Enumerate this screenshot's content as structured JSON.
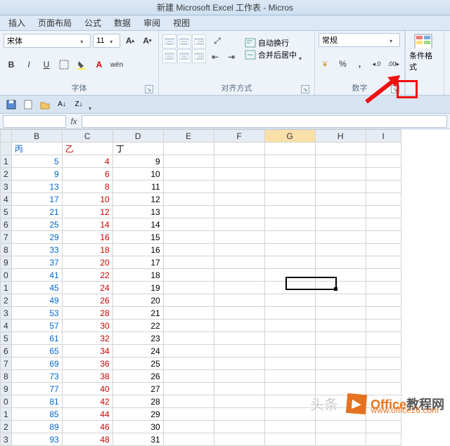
{
  "title": "新建 Microsoft Excel 工作表 - Micros",
  "tabs": {
    "insert": "插入",
    "layout": "页面布局",
    "formula": "公式",
    "data": "数据",
    "review": "审阅",
    "view": "视图"
  },
  "font": {
    "family": "宋体",
    "size": "11",
    "bold": "B",
    "italic": "I",
    "underline": "U"
  },
  "groups": {
    "font": "字体",
    "align": "对齐方式",
    "number": "数字",
    "style": "条件格式"
  },
  "align": {
    "wrap": "自动换行",
    "merge": "合并后居中"
  },
  "number": {
    "format": "常规",
    "pct": "%",
    "comma": ",",
    "inc": ".0",
    "dec": ".00"
  },
  "columns": [
    "B",
    "C",
    "D",
    "E",
    "F",
    "G",
    "H",
    "I"
  ],
  "headers": {
    "B": "丙",
    "C": "乙",
    "D": "丁"
  },
  "rows": [
    {
      "r": "1",
      "B": 5,
      "C": 4,
      "D": 9
    },
    {
      "r": "2",
      "B": 9,
      "C": 6,
      "D": 10
    },
    {
      "r": "3",
      "B": 13,
      "C": 8,
      "D": 11
    },
    {
      "r": "4",
      "B": 17,
      "C": 10,
      "D": 12
    },
    {
      "r": "5",
      "B": 21,
      "C": 12,
      "D": 13
    },
    {
      "r": "6",
      "B": 25,
      "C": 14,
      "D": 14
    },
    {
      "r": "7",
      "B": 29,
      "C": 16,
      "D": 15
    },
    {
      "r": "8",
      "B": 33,
      "C": 18,
      "D": 16
    },
    {
      "r": "9",
      "B": 37,
      "C": 20,
      "D": 17
    },
    {
      "r": "0",
      "B": 41,
      "C": 22,
      "D": 18
    },
    {
      "r": "1",
      "B": 45,
      "C": 24,
      "D": 19
    },
    {
      "r": "2",
      "B": 49,
      "C": 26,
      "D": 20
    },
    {
      "r": "3",
      "B": 53,
      "C": 28,
      "D": 21
    },
    {
      "r": "4",
      "B": 57,
      "C": 30,
      "D": 22
    },
    {
      "r": "5",
      "B": 61,
      "C": 32,
      "D": 23
    },
    {
      "r": "6",
      "B": 65,
      "C": 34,
      "D": 24
    },
    {
      "r": "7",
      "B": 69,
      "C": 36,
      "D": 25
    },
    {
      "r": "8",
      "B": 73,
      "C": 38,
      "D": 26
    },
    {
      "r": "9",
      "B": 77,
      "C": 40,
      "D": 27
    },
    {
      "r": "0",
      "B": 81,
      "C": 42,
      "D": 28
    },
    {
      "r": "1",
      "B": 85,
      "C": 44,
      "D": 29
    },
    {
      "r": "2",
      "B": 89,
      "C": 46,
      "D": 30
    },
    {
      "r": "3",
      "B": 93,
      "C": 48,
      "D": 31
    }
  ],
  "watermark": {
    "brand1": "Office",
    "brand2": "教程网",
    "url": "www.office26.com",
    "faint": "头条"
  }
}
